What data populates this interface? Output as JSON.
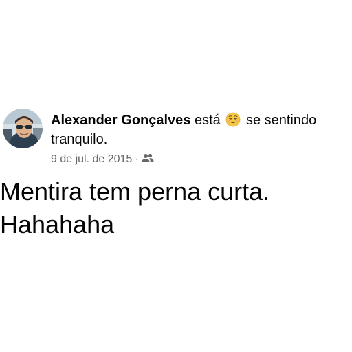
{
  "post": {
    "author": "Alexander Gonçalves",
    "feeling_prefix": "está",
    "feeling_icon": "relieved-face-emoji",
    "feeling_suffix": "se sentindo",
    "feeling_line2": "tranquilo.",
    "date": "9 de jul. de 2015",
    "separator": "·",
    "audience_icon": "friends-icon",
    "text_line1": "Mentira tem perna curta.",
    "text_line2": "Hahahaha"
  }
}
